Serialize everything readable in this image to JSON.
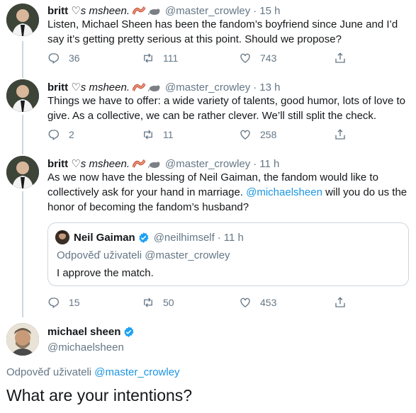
{
  "tweets": [
    {
      "name": "britt",
      "name_symbols": "♡s msheen.",
      "handle": "@master_crowley",
      "time": "15 h",
      "text": "Listen, Michael Sheen has been the fandom’s boyfriend since June and I’d say it’s getting pretty serious at this point. Should we propose?",
      "replies": "36",
      "retweets": "111",
      "likes": "743"
    },
    {
      "name": "britt",
      "name_symbols": "♡s msheen.",
      "handle": "@master_crowley",
      "time": "13 h",
      "text": "Things we have to offer: a wide variety of talents, good humor, lots of love to give. As a collective, we can be rather clever. We’ll still split the check.",
      "replies": "2",
      "retweets": "11",
      "likes": "258"
    },
    {
      "name": "britt",
      "name_symbols": "♡s msheen.",
      "handle": "@master_crowley",
      "time": "11 h",
      "text_part1": "As we now have the blessing of Neil Gaiman, the fandom would like to collectively ask for your hand in marriage. ",
      "mention": "@michaelsheen",
      "text_part2": " will you do us the honor of becoming the fandom’s husband?",
      "replies": "15",
      "retweets": "50",
      "likes": "453",
      "quote": {
        "name": "Neil Gaiman",
        "handle": "@neilhimself",
        "time": "11 h",
        "reply_to": "Odpověď uživateli @master_crowley",
        "text": "I approve the match."
      }
    }
  ],
  "main": {
    "name": "michael sheen",
    "handle": "@michaelsheen",
    "reply_to_label": "Odpověď uživateli ",
    "reply_to_mention": "@master_crowley",
    "text": "What are your intentions?"
  },
  "colors": {
    "accent": "#1b95e0",
    "muted": "#657786",
    "border": "#ccd6dd"
  },
  "icons": [
    "reply-icon",
    "retweet-icon",
    "like-icon",
    "share-icon",
    "verified-icon",
    "bacon-emoji",
    "rat-emoji"
  ]
}
